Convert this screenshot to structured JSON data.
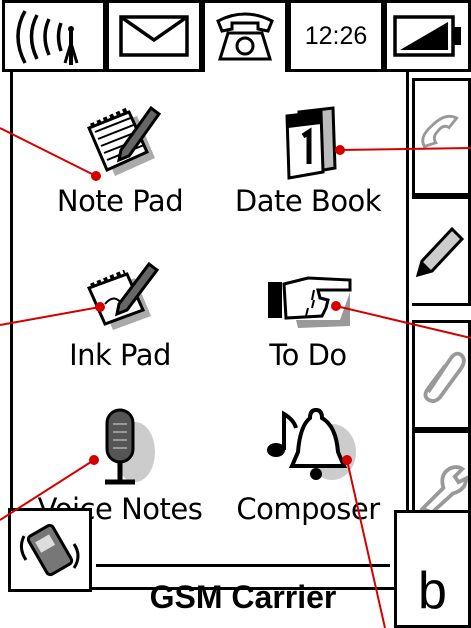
{
  "status_bar": {
    "signal_icon": "signal-strength-icon",
    "message_icon": "envelope-icon",
    "phone_icon": "telephone-icon",
    "time": "12:26",
    "battery_icon": "battery-icon"
  },
  "apps": [
    {
      "label": "Note Pad",
      "icon": "notepad-icon"
    },
    {
      "label": "Date Book",
      "icon": "datebook-icon"
    },
    {
      "label": "Ink Pad",
      "icon": "inkpad-icon"
    },
    {
      "label": "To Do",
      "icon": "todo-hand-icon"
    },
    {
      "label": "Voice Notes",
      "icon": "microphone-icon"
    },
    {
      "label": "Composer",
      "icon": "bell-music-icon"
    }
  ],
  "side_tabs": [
    "phone-tab-icon",
    "pencil-tab-icon",
    "paperclip-tab-icon",
    "wrench-tab-icon"
  ],
  "bottom": {
    "carrier": "GSM Carrier",
    "key_label": "b"
  },
  "colors": {
    "annotation": "#d40000",
    "line": "#000000"
  }
}
